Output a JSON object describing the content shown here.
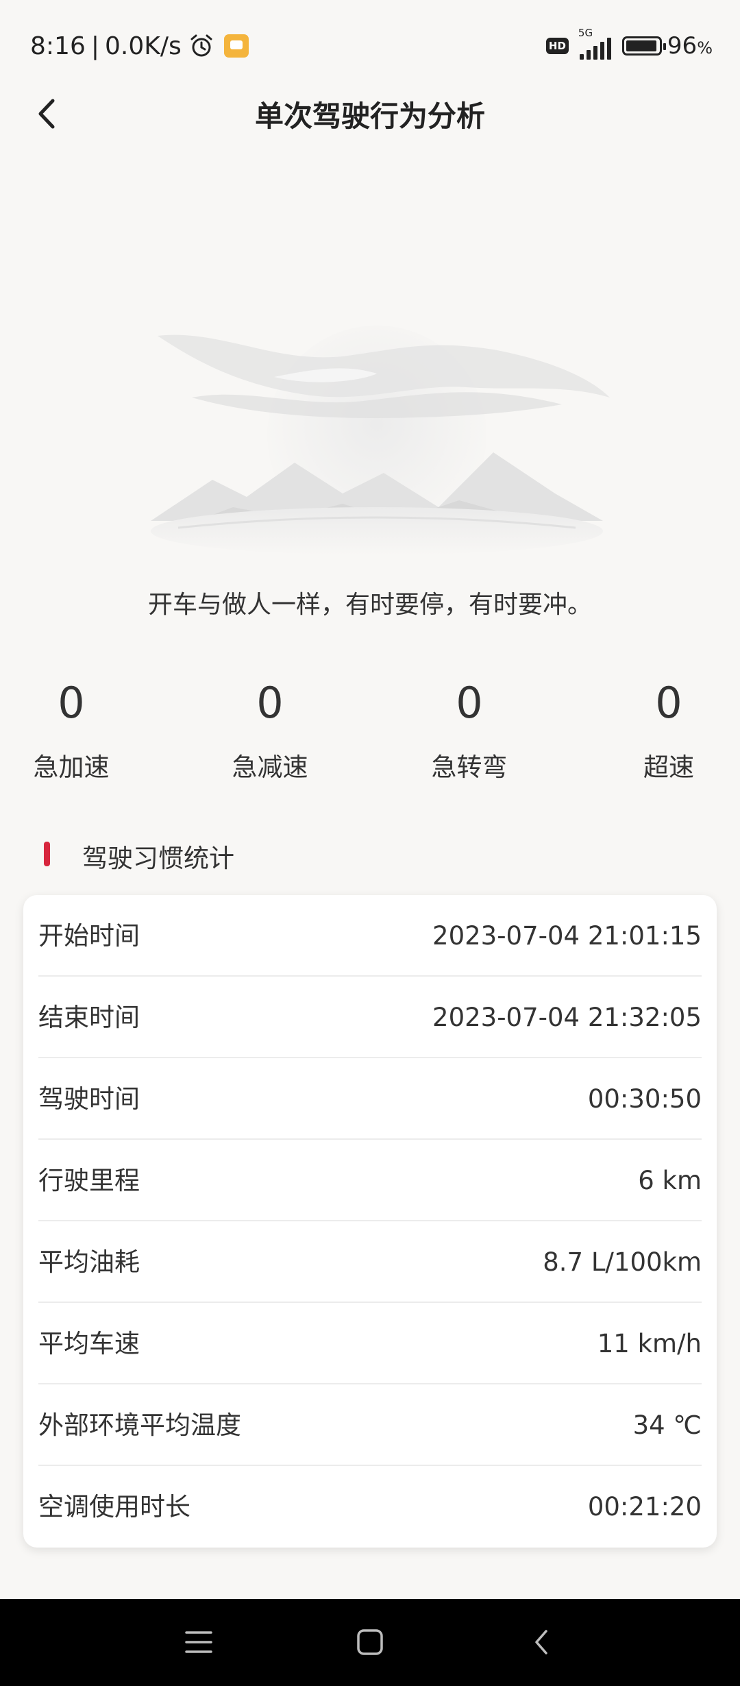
{
  "status_bar": {
    "time": "8:16",
    "separator": "|",
    "network_speed": "0.0K/s",
    "hd_badge": "HD",
    "network_type": "5G",
    "battery_percent": "96",
    "battery_unit": "%",
    "battery_level": 0.96,
    "icons": [
      "alarm-icon",
      "message-icon",
      "signal-icon",
      "battery-icon"
    ]
  },
  "header": {
    "title": "单次驾驶行为分析",
    "back_icon": "chevron-left-icon"
  },
  "illustration": {
    "icon": "empty-state-landscape-illustration"
  },
  "motto": "开车与做人一样，有时要停，有时要冲。",
  "counts": [
    {
      "value": "0",
      "label": "急加速"
    },
    {
      "value": "0",
      "label": "急减速"
    },
    {
      "value": "0",
      "label": "急转弯"
    },
    {
      "value": "0",
      "label": "超速"
    }
  ],
  "section": {
    "title": "驾驶习惯统计",
    "accent_color": "#d7263d"
  },
  "stats": [
    {
      "label": "开始时间",
      "value": "2023-07-04 21:01:15"
    },
    {
      "label": "结束时间",
      "value": "2023-07-04 21:32:05"
    },
    {
      "label": "驾驶时间",
      "value": "00:30:50"
    },
    {
      "label": "行驶里程",
      "value": "6 km"
    },
    {
      "label": "平均油耗",
      "value": "8.7 L/100km"
    },
    {
      "label": "平均车速",
      "value": "11 km/h"
    },
    {
      "label": "外部环境平均温度",
      "value": "34 ℃"
    },
    {
      "label": "空调使用时长",
      "value": "00:21:20"
    }
  ],
  "nav_bar": {
    "icons": [
      "menu-icon",
      "home-icon",
      "back-icon"
    ]
  }
}
